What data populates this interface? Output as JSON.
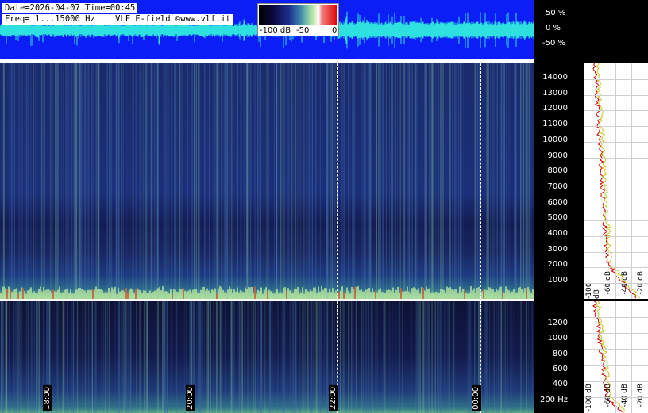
{
  "header": {
    "date_line": "Date=2026-04-07 Time=00:45",
    "freq_line": "Freq= 1...15000 Hz    VLF E-field ©www.vlf.it"
  },
  "colorbar": {
    "labels": [
      "-100 dB",
      "-50",
      "0"
    ]
  },
  "amplitude_scale": {
    "labels": [
      "50 %",
      "0 %",
      "-50 %"
    ]
  },
  "time_axis": {
    "labels": [
      "18:00",
      "20:00",
      "22:00",
      "00:00"
    ]
  },
  "freq_axis_top": {
    "labels": [
      "14000",
      "13000",
      "12000",
      "11000",
      "10000",
      "9000",
      "8000",
      "7000",
      "6000",
      "5000",
      "4000",
      "3000",
      "2000",
      "1000"
    ]
  },
  "freq_axis_bottom": {
    "labels": [
      "1200",
      "1000",
      "800",
      "600",
      "400",
      "200 Hz"
    ]
  },
  "db_scale": {
    "labels": [
      "-100 dB",
      "-60 dB",
      "-40 dB",
      "-20 dB"
    ]
  },
  "colors": {
    "waveform_bg": "#0a1ef5",
    "waveform_trace": "#2fe0e0",
    "profile_red": "#d00000",
    "profile_yellow": "#c8c820"
  }
}
